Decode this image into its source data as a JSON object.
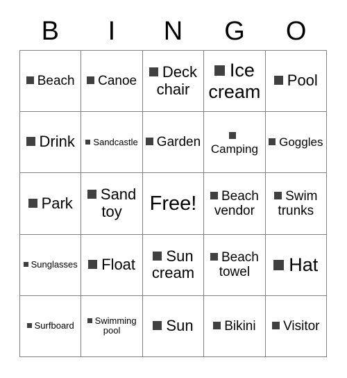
{
  "card": {
    "header": {
      "letters": [
        "B",
        "I",
        "N",
        "G",
        "O"
      ]
    },
    "grid": {
      "rows": 5,
      "columns": 5,
      "bullet_color": "#404040",
      "border_color": "#808080",
      "background_color": "#FFFFFF",
      "text_color": "#000000",
      "cells": [
        [
          {
            "label": "Beach",
            "bullet": true,
            "size": "md"
          },
          {
            "label": "Canoe",
            "bullet": true,
            "size": "md"
          },
          {
            "label": "Deck chair",
            "bullet": true,
            "size": "lg"
          },
          {
            "label": "Ice cream",
            "bullet": true,
            "size": "xl"
          },
          {
            "label": "Pool",
            "bullet": true,
            "size": "lg"
          }
        ],
        [
          {
            "label": "Drink",
            "bullet": true,
            "size": "lg"
          },
          {
            "label": "Sandcastle",
            "bullet": true,
            "size": "xs"
          },
          {
            "label": "Garden",
            "bullet": true,
            "size": "md"
          },
          {
            "label": "Camping",
            "bullet": true,
            "size": "sm"
          },
          {
            "label": "Goggles",
            "bullet": true,
            "size": "sm"
          }
        ],
        [
          {
            "label": "Park",
            "bullet": true,
            "size": "lg"
          },
          {
            "label": "Sand toy",
            "bullet": true,
            "size": "lg"
          },
          {
            "label": "Free!",
            "bullet": false,
            "size": "free"
          },
          {
            "label": "Beach vendor",
            "bullet": true,
            "size": "md"
          },
          {
            "label": "Swim trunks",
            "bullet": true,
            "size": "md"
          }
        ],
        [
          {
            "label": "Sunglasses",
            "bullet": true,
            "size": "xs"
          },
          {
            "label": "Float",
            "bullet": true,
            "size": "lg"
          },
          {
            "label": "Sun cream",
            "bullet": true,
            "size": "lg"
          },
          {
            "label": "Beach towel",
            "bullet": true,
            "size": "md"
          },
          {
            "label": "Hat",
            "bullet": true,
            "size": "xl"
          }
        ],
        [
          {
            "label": "Surfboard",
            "bullet": true,
            "size": "xs"
          },
          {
            "label": "Swimming pool",
            "bullet": true,
            "size": "xs"
          },
          {
            "label": "Sun",
            "bullet": true,
            "size": "lg"
          },
          {
            "label": "Bikini",
            "bullet": true,
            "size": "md"
          },
          {
            "label": "Visitor",
            "bullet": true,
            "size": "md"
          }
        ]
      ]
    }
  }
}
